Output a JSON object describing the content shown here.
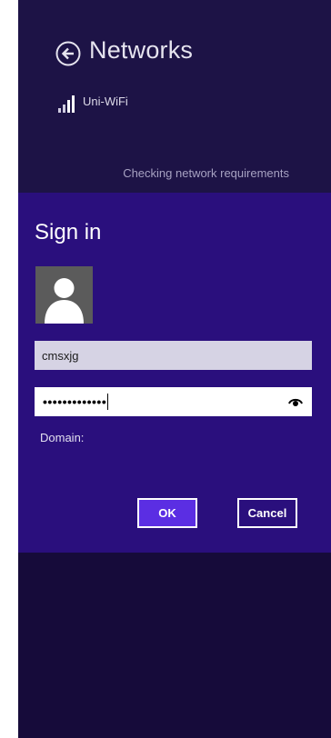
{
  "header": {
    "title": "Networks",
    "network_name": "Uni-WiFi",
    "status": "Checking network requirements"
  },
  "signin": {
    "title": "Sign in",
    "username": "cmsxjg",
    "password_mask": "•••••••••••••",
    "domain_label": "Domain:",
    "ok_label": "OK",
    "cancel_label": "Cancel"
  },
  "icons": {
    "back": "back-arrow-circle-icon",
    "signal": "wifi-signal-bars-icon",
    "avatar": "user-silhouette-icon",
    "reveal": "eye-reveal-icon"
  },
  "colors": {
    "charm_background": "#160b3a",
    "header_background": "#1d1346",
    "panel_background": "#2a0f7d",
    "ok_button": "#5b2ee3"
  }
}
